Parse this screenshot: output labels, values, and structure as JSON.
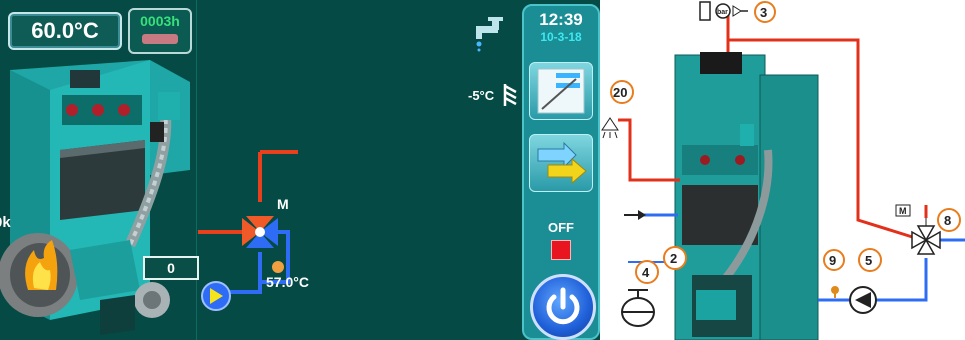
{
  "screen": {
    "boiler_temperature": "60.0°C",
    "operating_hours": "0003h",
    "fire_level_label": "0k",
    "fire_value": "0",
    "mixing_valve_label": "M",
    "mixing_temperature": "57.0°C",
    "outdoor_temperature": "-5°C",
    "time": "12:39",
    "date": "10-3-18",
    "status": "OFF",
    "colors": {
      "background": "#054a44",
      "panel": "#1b8e95",
      "hot_pipe": "#e8401d",
      "cold_pipe": "#2e6cf5",
      "off_led": "#e8141f"
    },
    "icons": [
      "tap-water-icon",
      "outdoor-sensor-icon",
      "heating-curve-icon",
      "swap-arrows-icon",
      "power-icon",
      "pump-icon",
      "mixing-valve-icon"
    ]
  },
  "schema": {
    "callouts": [
      "3",
      "20",
      "2",
      "4",
      "9",
      "5",
      "8"
    ],
    "valve_motor_label": "M",
    "pressure_gauge_label": "bar",
    "icons": [
      "pressure-gauge-icon",
      "safety-valve-icon",
      "thermometer-icon",
      "shower-head-icon",
      "expansion-vessel-icon",
      "pump-icon",
      "three-way-valve-icon",
      "arrow-right-icon"
    ]
  }
}
